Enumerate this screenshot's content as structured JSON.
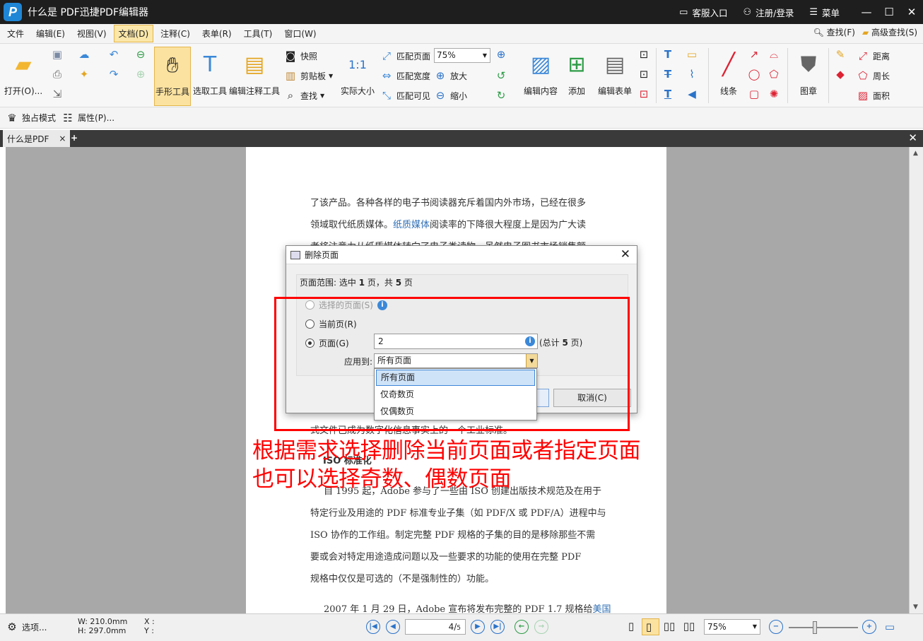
{
  "app": {
    "logo_letter": "P",
    "title": "什么是 PDF迅捷PDF编辑器"
  },
  "titlebar": {
    "support": "客服入口",
    "login": "注册/登录",
    "menu": "菜单"
  },
  "menubar": {
    "items": [
      "文件",
      "编辑(E)",
      "视图(V)",
      "文档(D)",
      "注释(C)",
      "表单(R)",
      "工具(T)",
      "窗口(W)"
    ],
    "active_index": 3,
    "find": "查找(F)",
    "advanced_find": "高级查找(S)"
  },
  "toolbar": {
    "open": "打开(O)...",
    "hand_tool": "手形工具",
    "select_tool": "选取工具",
    "edit_annot_tool": "编辑注释工具",
    "snapshot": "快照",
    "clipboard": "剪贴板",
    "find": "查找",
    "actual_size": "实际大小",
    "actual_size_icon_text": "1:1",
    "fit_page": "匹配页面",
    "fit_width": "匹配宽度",
    "fit_visible": "匹配可见",
    "zoom_value": "75%",
    "zoom_in": "放大",
    "zoom_out": "缩小",
    "edit_content": "编辑内容",
    "add": "添加",
    "edit_form": "编辑表单",
    "line": "线条",
    "stamp": "图章",
    "distance": "距离",
    "perimeter": "周长",
    "area": "面积"
  },
  "subbar": {
    "exclusive_mode": "独占模式",
    "properties": "属性(P)..."
  },
  "tabs": {
    "doc_tab": "什么是PDF"
  },
  "page": {
    "lines_top": [
      {
        "text": "了该产品。各种各样的电子书阅读器充斥着国内外市场，已经在很多"
      },
      {
        "pre": "领域取代纸质媒体。",
        "link": "纸质媒体",
        "post": "阅读率的下降很大程度上是因为广大读"
      },
      {
        "text": "者将注意力从纸质媒体转向了电子类读物，虽然电子图书市场销售额"
      }
    ],
    "line_mid": "式文件已成为数字化信息事实上的一个工业标准。",
    "heading": "ISO 标准化",
    "lines_bottom": [
      "自 1995 起，Adobe 参与了一些由 ISO 创建出版技术规范及在用于",
      "特定行业及用途的 PDF 标准专业子集（如 PDF/X 或 PDF/A）进程中与",
      "ISO 协作的工作组。制定完整 PDF 规格的子集的目的是移除那些不需",
      "要或会对特定用途造成问题以及一些要求的功能的使用在完整 PDF",
      "规格中仅仅是可选的（不是强制性的）功能。"
    ],
    "last_line_pre": "2007 年 1 月 29 日，Adobe 宣布将发布完整的 PDF 1.7 规格给",
    "last_line_link": "美国"
  },
  "dialog": {
    "title": "删除页面",
    "range_prefix": "页面范围: 选中 ",
    "range_selected": "1",
    "range_mid": " 页，共 ",
    "range_total": "5",
    "range_suffix": " 页",
    "opt_selected": "选择的页面(S)",
    "opt_current": "当前页(R)",
    "opt_pages": "页面(G)",
    "pages_value": "2",
    "total_prefix": "(总计 ",
    "total_value": "5",
    "total_suffix": " 页)",
    "apply_label": "应用到:",
    "apply_value": "所有页面",
    "apply_options": [
      "所有页面",
      "仅奇数页",
      "仅偶数页"
    ],
    "cancel": "取消(C)"
  },
  "annotation": {
    "line1": "根据需求选择删除当前页面或者指定页面",
    "line2": "也可以选择奇数、偶数页面"
  },
  "statusbar": {
    "options": "选项...",
    "width": "W: 210.0mm",
    "height": "H: 297.0mm",
    "x": "X :",
    "y": "Y :",
    "page_current": "4",
    "page_total": "5",
    "zoom": "75%"
  },
  "colors": {
    "accent": "#2b73c9",
    "annotation": "#ff0000",
    "active_tool": "#fbe2a0"
  }
}
